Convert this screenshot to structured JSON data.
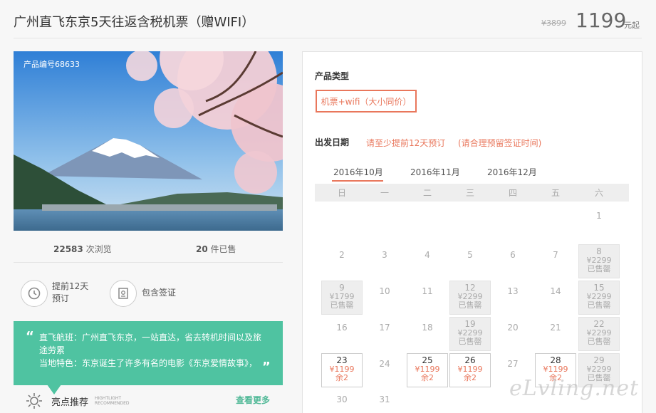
{
  "header": {
    "title": "广州直飞东京5天往返含税机票（赠WIFI）",
    "old_price": "¥3899",
    "price": "1199",
    "price_unit": "元起"
  },
  "hero": {
    "product_code": "产品编号68633"
  },
  "stats": {
    "views_num": "22583",
    "views_label": "次浏览",
    "sold_num": "20",
    "sold_label": "件已售"
  },
  "features": [
    {
      "icon": "clock-history-icon",
      "line1": "提前12天",
      "line2": "预订"
    },
    {
      "icon": "visa-document-icon",
      "line1": "包含签证"
    }
  ],
  "highlight": {
    "line1": "直飞航班：广州直飞东京，一站直达，省去转机时间以及旅",
    "line2": "途劳累",
    "line3": "当地特色：东京诞生了许多有名的电影《东京爱情故事》，",
    "label": "亮点推荐",
    "label_en1": "HIGHTLIGHT",
    "label_en2": "RECOMMENDED",
    "more": "查看更多"
  },
  "panel": {
    "product_type_label": "产品类型",
    "product_type_value": "机票+wifi（大小同价）",
    "date_label": "出发日期",
    "note1": "请至少提前12天预订",
    "note2": "(请合理预留签证时间)",
    "months": [
      "2016年10月",
      "2016年11月",
      "2016年12月"
    ],
    "weekdays": [
      "日",
      "一",
      "二",
      "三",
      "四",
      "五",
      "六"
    ]
  },
  "calendar": [
    {
      "day": "1",
      "col": 6,
      "row": 0
    },
    {
      "day": "2",
      "col": 0,
      "row": 1
    },
    {
      "day": "3",
      "col": 1,
      "row": 1
    },
    {
      "day": "4",
      "col": 2,
      "row": 1
    },
    {
      "day": "5",
      "col": 3,
      "row": 1
    },
    {
      "day": "6",
      "col": 4,
      "row": 1
    },
    {
      "day": "7",
      "col": 5,
      "row": 1
    },
    {
      "day": "8",
      "col": 6,
      "row": 1,
      "status": "sold",
      "price": "¥2299",
      "note": "已售罄"
    },
    {
      "day": "9",
      "col": 0,
      "row": 2,
      "status": "sold",
      "price": "¥1799",
      "note": "已售罄"
    },
    {
      "day": "10",
      "col": 1,
      "row": 2
    },
    {
      "day": "11",
      "col": 2,
      "row": 2
    },
    {
      "day": "12",
      "col": 3,
      "row": 2,
      "status": "sold",
      "price": "¥2299",
      "note": "已售罄"
    },
    {
      "day": "13",
      "col": 4,
      "row": 2
    },
    {
      "day": "14",
      "col": 5,
      "row": 2
    },
    {
      "day": "15",
      "col": 6,
      "row": 2,
      "status": "sold",
      "price": "¥2299",
      "note": "已售罄"
    },
    {
      "day": "16",
      "col": 0,
      "row": 3
    },
    {
      "day": "17",
      "col": 1,
      "row": 3
    },
    {
      "day": "18",
      "col": 2,
      "row": 3
    },
    {
      "day": "19",
      "col": 3,
      "row": 3,
      "status": "sold",
      "price": "¥2299",
      "note": "已售罄"
    },
    {
      "day": "20",
      "col": 4,
      "row": 3
    },
    {
      "day": "21",
      "col": 5,
      "row": 3
    },
    {
      "day": "22",
      "col": 6,
      "row": 3,
      "status": "sold",
      "price": "¥2299",
      "note": "已售罄"
    },
    {
      "day": "23",
      "col": 0,
      "row": 4,
      "status": "avail",
      "price": "¥1199",
      "note": "余2"
    },
    {
      "day": "24",
      "col": 1,
      "row": 4
    },
    {
      "day": "25",
      "col": 2,
      "row": 4,
      "status": "avail",
      "price": "¥1199",
      "note": "余2"
    },
    {
      "day": "26",
      "col": 3,
      "row": 4,
      "status": "avail",
      "price": "¥1199",
      "note": "余2"
    },
    {
      "day": "27",
      "col": 4,
      "row": 4
    },
    {
      "day": "28",
      "col": 5,
      "row": 4,
      "status": "avail",
      "price": "¥1199",
      "note": "余2"
    },
    {
      "day": "29",
      "col": 6,
      "row": 4,
      "status": "sold",
      "price": "¥2299",
      "note": "已售罄"
    },
    {
      "day": "30",
      "col": 0,
      "row": 5
    },
    {
      "day": "31",
      "col": 1,
      "row": 5
    }
  ],
  "watermark": "eLvling.net",
  "colors": {
    "accent": "#e9775c",
    "green": "#4fc3a1"
  }
}
